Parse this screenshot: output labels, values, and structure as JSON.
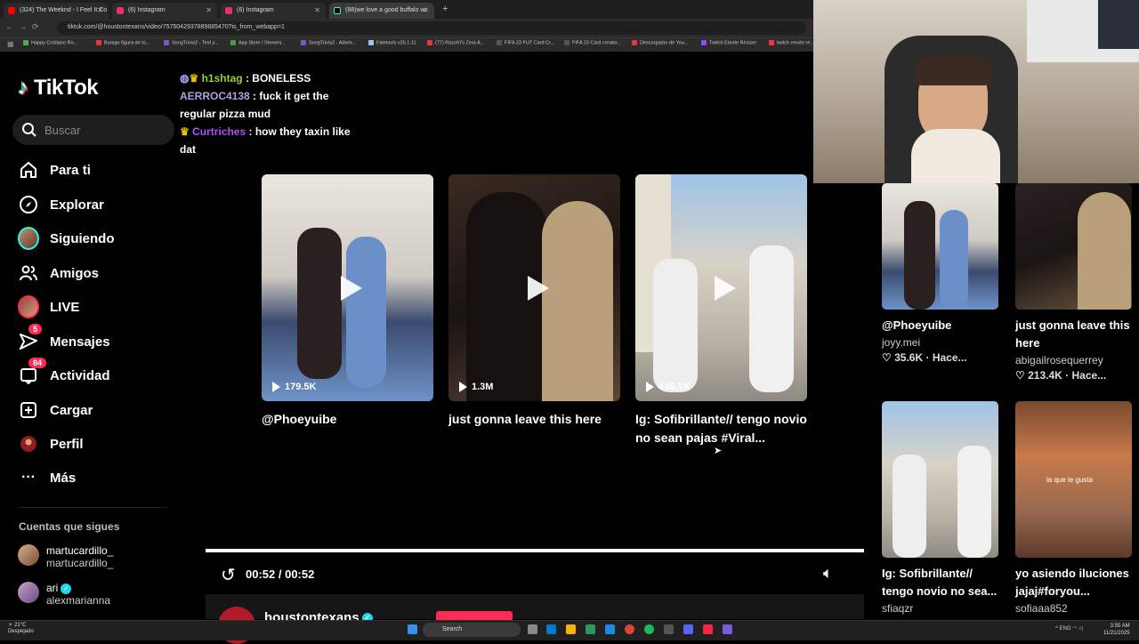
{
  "browser": {
    "tabs": [
      {
        "title": "(324) The Weeknd - I Feel It Co",
        "color": "#ff0000"
      },
      {
        "title": "(6) Instagram",
        "color": "#e1306c"
      },
      {
        "title": "(6) Instagram",
        "color": "#e1306c"
      },
      {
        "title": "(88)we love a good buffalo wi",
        "color": "#000000"
      }
    ],
    "new_tab": "+",
    "url": "tiktok.com/@houstontexans/video/7575042937889885470?is_from_webapp=1",
    "bookmarks": [
      {
        "label": "Happy Cristiano Ro...",
        "color": "#4caf50"
      },
      {
        "label": "Burago figura de to...",
        "color": "#e53935"
      },
      {
        "label": "SongTrivia2 - Test y...",
        "color": "#7e57c2"
      },
      {
        "label": "App Store / Streami...",
        "color": "#43a047"
      },
      {
        "label": "SongTrivia2 - Adivin...",
        "color": "#7e57c2"
      },
      {
        "label": "Faletools v25.1.11",
        "color": "#90caf9"
      },
      {
        "label": "(77) Razo97s Zest-A...",
        "color": "#e53935"
      },
      {
        "label": "FIFA 23 FUT Card Cr...",
        "color": "#555555"
      },
      {
        "label": "FIFA 23 Card creator...",
        "color": "#555555"
      },
      {
        "label": "Descargador de You...",
        "color": "#e53935"
      },
      {
        "label": "Twitch Emote Resizer",
        "color": "#9146ff"
      },
      {
        "label": "twitch emote re...",
        "color": "#fe2c55"
      }
    ]
  },
  "sidebar": {
    "logo": "TikTok",
    "search_placeholder": "Buscar",
    "items": [
      {
        "label": "Para ti",
        "icon": "home-icon"
      },
      {
        "label": "Explorar",
        "icon": "compass-icon"
      },
      {
        "label": "Siguiendo",
        "icon": "avatar-icon"
      },
      {
        "label": "Amigos",
        "icon": "friends-icon"
      },
      {
        "label": "LIVE",
        "icon": "live-icon"
      },
      {
        "label": "Mensajes",
        "icon": "send-icon",
        "badge": "5"
      },
      {
        "label": "Actividad",
        "icon": "inbox-icon",
        "badge": "84"
      },
      {
        "label": "Cargar",
        "icon": "upload-icon"
      },
      {
        "label": "Perfil",
        "icon": "profile-icon"
      },
      {
        "label": "Más",
        "icon": "more-icon"
      }
    ],
    "following_title": "Cuentas que sigues",
    "following": [
      {
        "name": "martucardillo_",
        "handle": "martucardillo_",
        "verified": false
      },
      {
        "name": "ari",
        "handle": "alexmarianna",
        "verified": true
      }
    ]
  },
  "chat": [
    {
      "user": "h1shtag",
      "message": "BONELESS",
      "color": "#9acd32"
    },
    {
      "user": "AERROC4138",
      "message": "fuck it get the regular pizza mud",
      "color": "#b39ddb"
    },
    {
      "user": "Curtriches",
      "message": "how they taxin like dat",
      "color": "#a855f7"
    }
  ],
  "videos": [
    {
      "views": "179.5K",
      "desc": "@Phoeyuibe"
    },
    {
      "views": "1.3M",
      "desc": "just gonna leave this here"
    },
    {
      "views": "440.1K",
      "desc": "Ig: Sofibrillante// tengo novio no sean pajas #Viral..."
    }
  ],
  "related": [
    {
      "desc": "@Phoeyuibe",
      "author": "joyy.mei",
      "likes": "35.6K",
      "time": "Hace..."
    },
    {
      "desc": "just gonna leave this here",
      "author": "abigailrosequerrey",
      "likes": "213.4K",
      "time": "Hace..."
    },
    {
      "desc": "Ig: Sofibrillante// tengo novio no sea...",
      "author": "sfiaqzr"
    },
    {
      "desc": "yo asiendo iluciones jajaj#foryou...",
      "author": "sofiaaa852",
      "overlay": "la que le gusta"
    }
  ],
  "player": {
    "time": "00:52 / 00:52",
    "progress": 1.0,
    "author": "houstontexans"
  },
  "taskbar": {
    "weather_temp": "21°C",
    "weather_desc": "Despejado",
    "search": "Search",
    "lang": "ENG",
    "time": "3:55 AM",
    "date": "11/21/2025"
  }
}
